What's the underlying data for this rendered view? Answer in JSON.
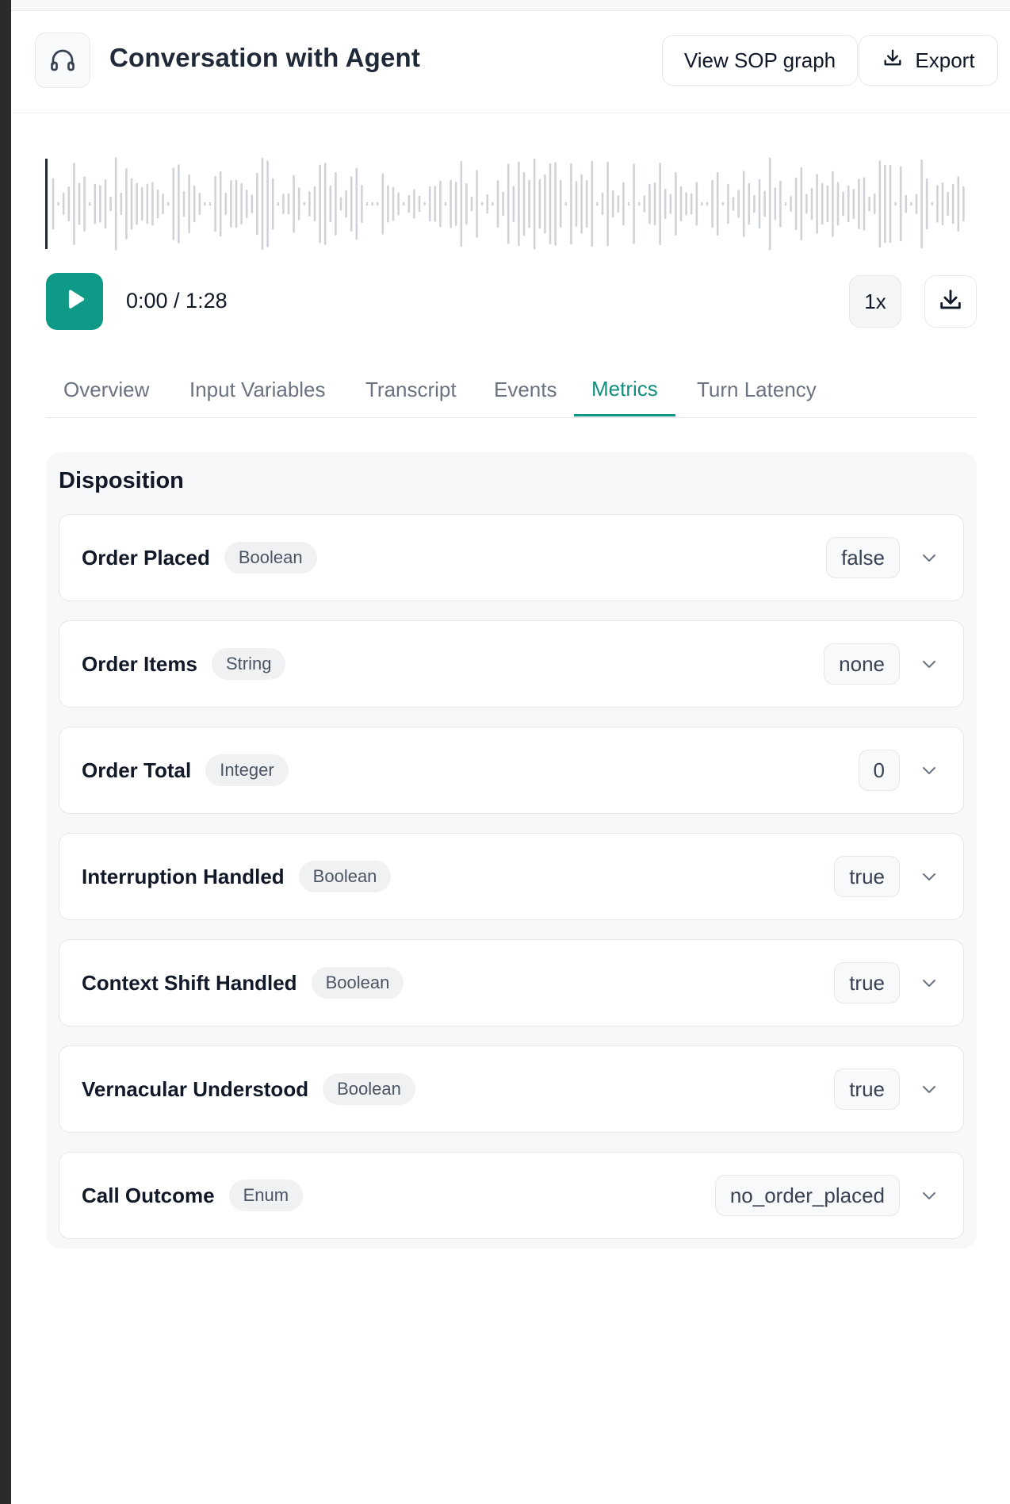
{
  "header": {
    "title": "Conversation with Agent",
    "icon": "headphones-icon",
    "view_sop_label": "View SOP graph",
    "export_label": "Export"
  },
  "player": {
    "time": "0:00 / 1:28",
    "speed": "1x",
    "progress": 0,
    "accent_color": "#0f9a87"
  },
  "tabs": [
    {
      "label": "Overview",
      "active": false
    },
    {
      "label": "Input Variables",
      "active": false
    },
    {
      "label": "Transcript",
      "active": false
    },
    {
      "label": "Events",
      "active": false
    },
    {
      "label": "Metrics",
      "active": true
    },
    {
      "label": "Turn Latency",
      "active": false
    }
  ],
  "metrics": {
    "title": "Disposition",
    "items": [
      {
        "name": "Order Placed",
        "type": "Boolean",
        "value": "false"
      },
      {
        "name": "Order Items",
        "type": "String",
        "value": "none"
      },
      {
        "name": "Order Total",
        "type": "Integer",
        "value": "0"
      },
      {
        "name": "Interruption Handled",
        "type": "Boolean",
        "value": "true"
      },
      {
        "name": "Context Shift Handled",
        "type": "Boolean",
        "value": "true"
      },
      {
        "name": "Vernacular Understood",
        "type": "Boolean",
        "value": "true"
      },
      {
        "name": "Call Outcome",
        "type": "Enum",
        "value": "no_order_placed"
      }
    ]
  }
}
